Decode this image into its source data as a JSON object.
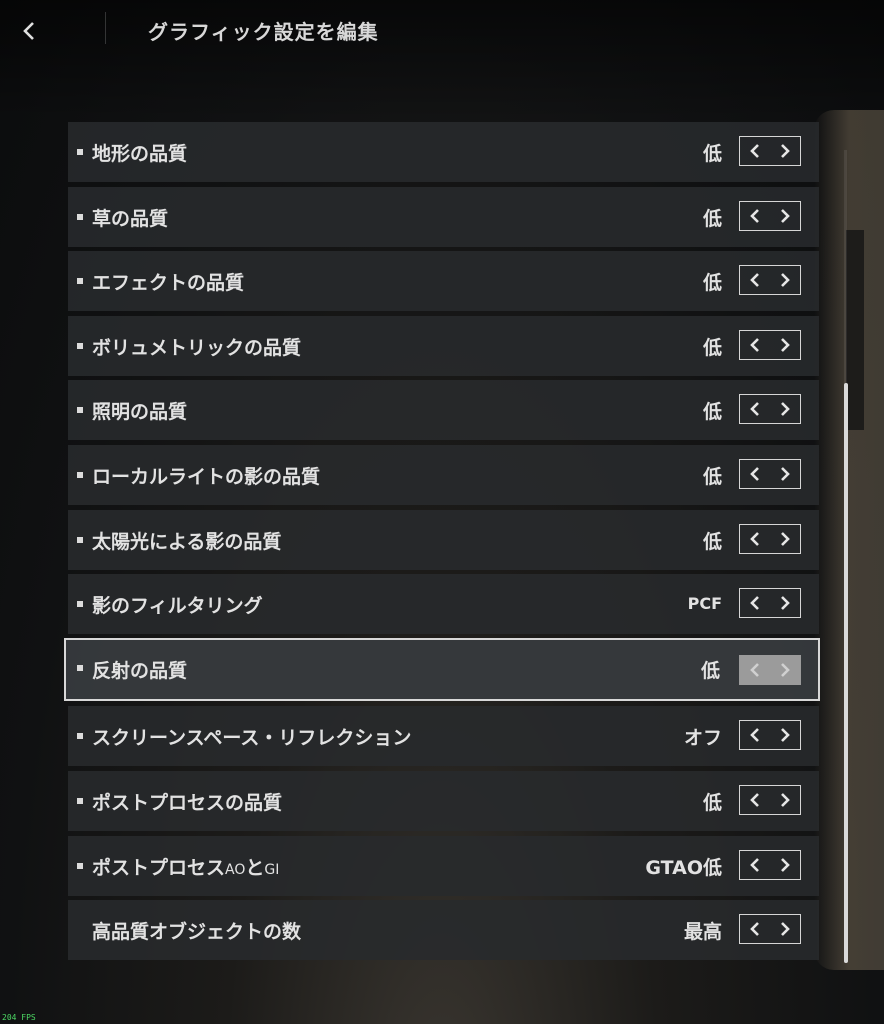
{
  "header": {
    "title": "グラフィック設定を編集"
  },
  "settings": [
    {
      "label": "地形の品質",
      "value": "低",
      "bullet": true
    },
    {
      "label": "草の品質",
      "value": "低",
      "bullet": true
    },
    {
      "label": "エフェクトの品質",
      "value": "低",
      "bullet": true
    },
    {
      "label": "ボリュメトリックの品質",
      "value": "低",
      "bullet": true
    },
    {
      "label": "照明の品質",
      "value": "低",
      "bullet": true
    },
    {
      "label": "ローカルライトの影の品質",
      "value": "低",
      "bullet": true
    },
    {
      "label": "太陽光による影の品質",
      "value": "低",
      "bullet": true
    },
    {
      "label": "影のフィルタリング",
      "value": "PCF",
      "bullet": true
    },
    {
      "label": "反射の品質",
      "value": "低",
      "bullet": true,
      "selected": true
    },
    {
      "label": "スクリーンスペース・リフレクション",
      "value": "オフ",
      "bullet": true
    },
    {
      "label": "ポストプロセスの品質",
      "value": "低",
      "bullet": true
    },
    {
      "label_main": "ポストプロセス",
      "label_ao": "AO",
      "label_to": "と",
      "label_gi": "GI",
      "value": "GTAO低",
      "bullet": true
    },
    {
      "label": "高品質オブジェクトの数",
      "value": "最高",
      "bullet": false
    }
  ],
  "fps_counter": "204 FPS",
  "colors": {
    "row_bg": "#2a2c2e",
    "selected_border": "#d8d8d8",
    "text": "#e2e2e2",
    "fps": "#4cd964"
  }
}
